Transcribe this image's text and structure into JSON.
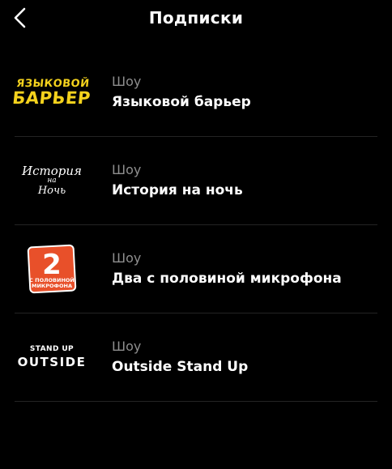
{
  "header": {
    "back_icon": "chevron-left-icon",
    "title": "Подписки"
  },
  "subscriptions": [
    {
      "category": "Шоу",
      "name": "Языковой барьер",
      "logo": {
        "line1": "ЯЗЫКОВОЙ",
        "line2": "БАРЬЕР",
        "color": "#f4d21d"
      }
    },
    {
      "category": "Шоу",
      "name": "История на ночь",
      "logo": {
        "line1": "История",
        "line2": "на",
        "line3": "Ночь",
        "color": "#ffffff"
      }
    },
    {
      "category": "Шоу",
      "name": "Два с половиной микрофона",
      "logo": {
        "digit": "2",
        "line1": "С ПОЛОВИНОЙ",
        "line2": "МИКРОФОНА",
        "color": "#e8502a"
      }
    },
    {
      "category": "Шоу",
      "name": "Outside Stand Up",
      "logo": {
        "line1": "STAND UP",
        "line2": "OUTSIDE",
        "color": "#ffffff"
      }
    }
  ],
  "colors": {
    "background": "#000000",
    "text": "#ffffff",
    "secondary_text": "#8e8e8e",
    "divider": "#242424"
  }
}
